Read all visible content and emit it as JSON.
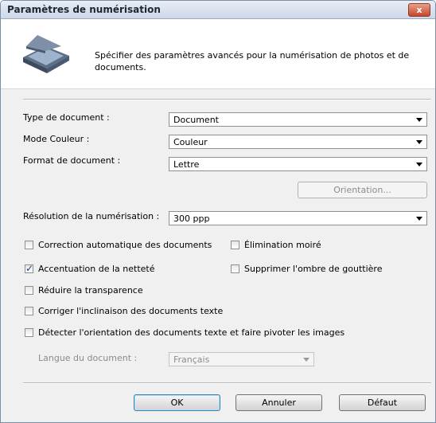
{
  "window": {
    "title": "Paramètres de numérisation",
    "close_glyph": "x"
  },
  "header": {
    "icon": "scanner-icon",
    "description_line1": "Spécifier des paramètres avancés pour la numérisation de photos et de",
    "description_line2": "documents."
  },
  "fields": {
    "doc_type": {
      "label": "Type de document :",
      "value": "Document"
    },
    "color_mode": {
      "label": "Mode Couleur :",
      "value": "Couleur"
    },
    "doc_format": {
      "label": "Format de document :",
      "value": "Lettre"
    },
    "orientation_button": "Orientation...",
    "resolution": {
      "label": "Résolution de la numérisation :",
      "value": "300 ppp"
    }
  },
  "options": {
    "auto_correction": {
      "label": "Correction automatique des documents",
      "checked": false
    },
    "moire": {
      "label": "Élimination moiré",
      "checked": false
    },
    "sharpen": {
      "label": "Accentuation de la netteté",
      "checked": true
    },
    "gutter_shadow": {
      "label": "Supprimer l'ombre de gouttière",
      "checked": false
    },
    "reduce_show_through": {
      "label": "Réduire la transparence",
      "checked": false
    },
    "skew": {
      "label": "Corriger l'inclinaison des documents texte",
      "checked": false
    },
    "detect_orientation": {
      "label": "Détecter l'orientation des documents texte et faire pivoter les images",
      "checked": false
    }
  },
  "language": {
    "label": "Langue du document :",
    "value": "Français"
  },
  "buttons": {
    "ok": "OK",
    "cancel": "Annuler",
    "default": "Défaut"
  },
  "colors": {
    "title_gradient_top": "#e9eef6",
    "title_gradient_bottom": "#cdd8e8",
    "dialog_bg": "#f0f0f0",
    "check_mark": "#1d3f8c"
  }
}
